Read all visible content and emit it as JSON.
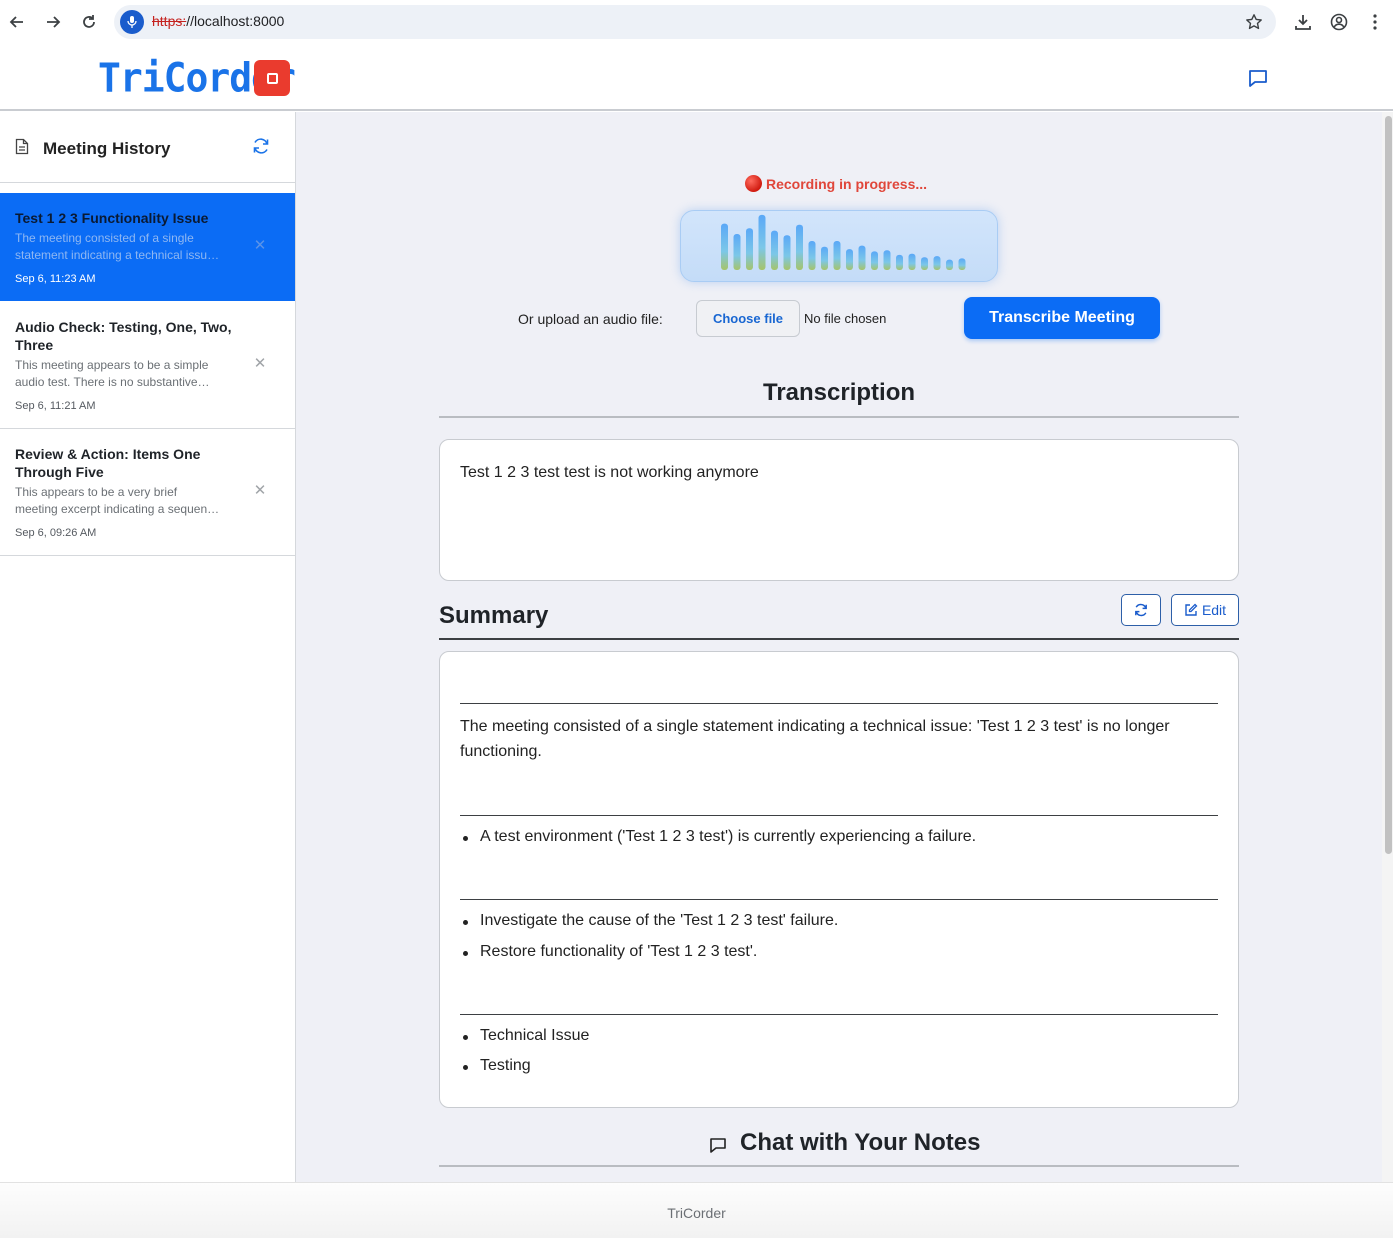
{
  "browser": {
    "url_protocol": "https:",
    "url_rest": "//localhost:8000"
  },
  "header": {
    "logo": "TriCorder"
  },
  "sidebar": {
    "title": "Meeting History",
    "items": [
      {
        "title": "Test 1 2 3 Functionality Issue",
        "desc_lines": [
          "The meeting consisted of a single",
          "statement indicating a technical issu…"
        ],
        "date": "Sep 6, 11:23 AM",
        "active": true
      },
      {
        "title": "Audio Check: Testing, One, Two, Three",
        "desc_lines": [
          "This meeting appears to be a simple",
          "audio test. There is no substantive…"
        ],
        "date": "Sep 6, 11:21 AM",
        "active": false
      },
      {
        "title": "Review & Action: Items One Through Five",
        "desc_lines": [
          "This appears to be a very brief",
          "meeting excerpt indicating a sequen…"
        ],
        "date": "Sep 6, 09:26 AM",
        "active": false
      }
    ]
  },
  "recorder": {
    "status": "Recording in progress...",
    "levels": [
      0.8,
      0.62,
      0.72,
      0.95,
      0.68,
      0.6,
      0.78,
      0.5,
      0.4,
      0.5,
      0.36,
      0.42,
      0.32,
      0.34,
      0.26,
      0.28,
      0.22,
      0.24,
      0.18,
      0.2,
      0.14,
      0.1,
      0.12,
      0.1,
      0.13,
      0.08,
      0.1,
      0.08
    ]
  },
  "upload": {
    "label": "Or upload an audio file:",
    "choose_label": "Choose file",
    "no_file": "No file chosen",
    "transcribe_label": "Transcribe Meeting"
  },
  "transcription": {
    "heading": "Transcription",
    "text": "Test 1 2 3 test test is not working anymore"
  },
  "summary": {
    "heading": "Summary",
    "edit_label": "Edit",
    "overview_line1": "The meeting consisted of a single statement indicating a technical issue: 'Test 1 2 3 test' is no longer",
    "overview_line2": "functioning.",
    "key_points": [
      "A test environment ('Test 1 2 3 test') is currently experiencing a failure."
    ],
    "action_items": [
      "Investigate the cause of the 'Test 1 2 3 test' failure.",
      "Restore functionality of 'Test 1 2 3 test'."
    ],
    "tags": [
      "Technical Issue",
      "Testing"
    ]
  },
  "chat": {
    "heading": "Chat with Your Notes"
  },
  "footer": {
    "text": "TriCorder"
  },
  "colors": {
    "accent": "#0b6cf5",
    "record_red": "#ea3b2e",
    "status_red": "#e0463a"
  }
}
